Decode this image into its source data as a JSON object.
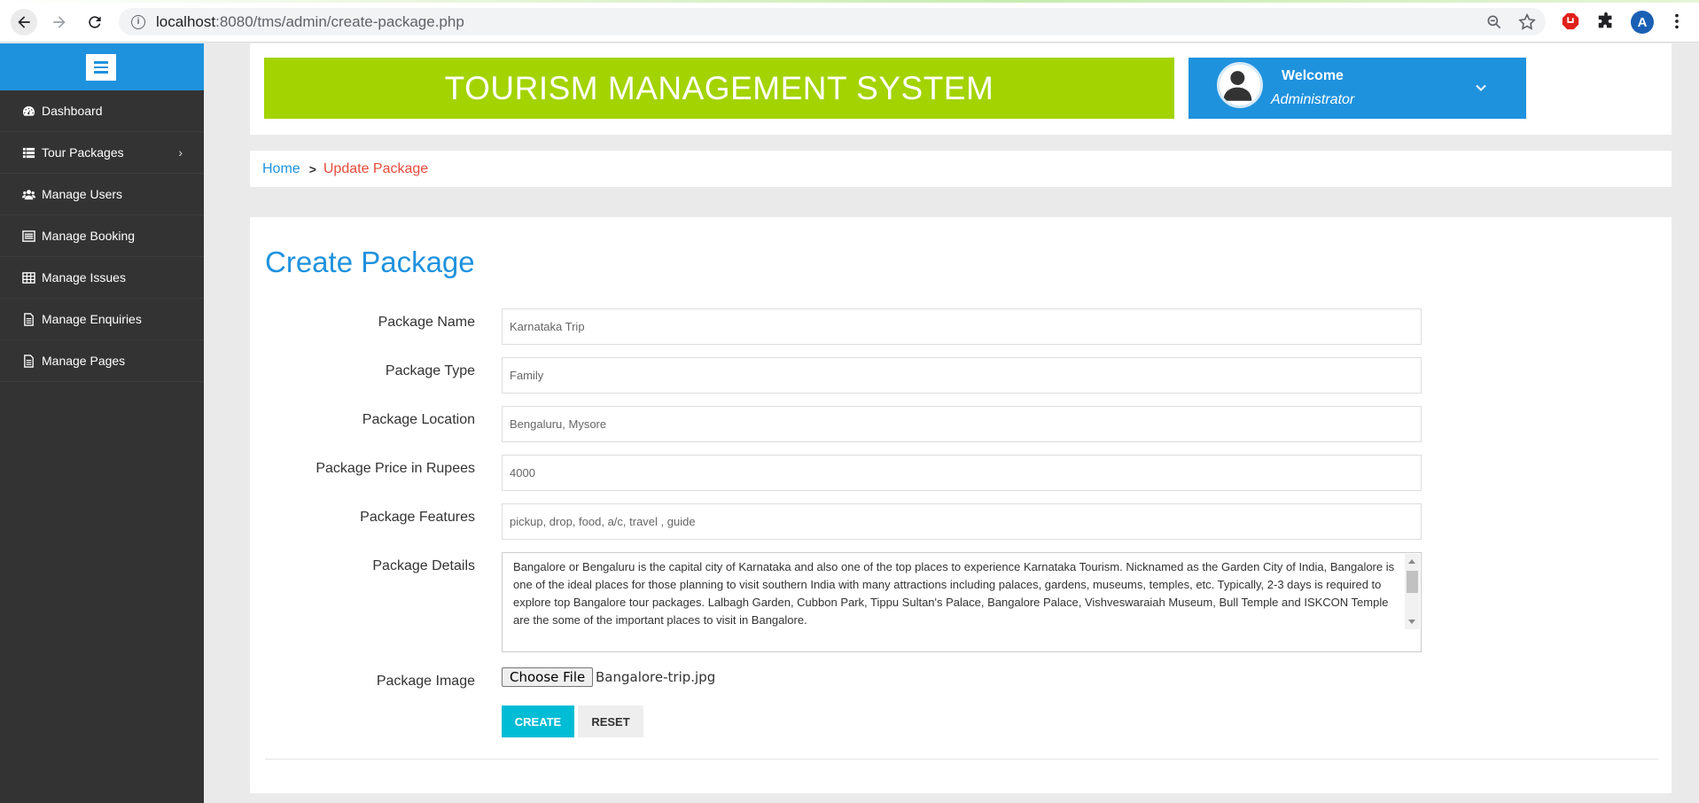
{
  "browser": {
    "url_host": "localhost",
    "url_path": ":8080/tms/admin/create-package.php",
    "avatar_letter": "A"
  },
  "sidebar": {
    "items": [
      {
        "label": "Dashboard",
        "icon": "dashboard-icon"
      },
      {
        "label": "Tour Packages",
        "icon": "list-icon",
        "has_submenu": true
      },
      {
        "label": "Manage Users",
        "icon": "users-icon"
      },
      {
        "label": "Manage Booking",
        "icon": "list-alt-icon"
      },
      {
        "label": "Manage Issues",
        "icon": "table-icon"
      },
      {
        "label": "Manage Enquiries",
        "icon": "file-icon"
      },
      {
        "label": "Manage Pages",
        "icon": "file-icon"
      }
    ]
  },
  "header": {
    "title": "TOURISM MANAGEMENT SYSTEM",
    "welcome": "Welcome",
    "role": "Administrator"
  },
  "breadcrumb": {
    "home": "Home",
    "current": "Update Package"
  },
  "form": {
    "title": "Create Package",
    "fields": [
      {
        "label": "Package Name",
        "value": "Karnataka Trip"
      },
      {
        "label": "Package Type",
        "value": "Family"
      },
      {
        "label": "Package Location",
        "value": "Bengaluru, Mysore"
      },
      {
        "label": "Package Price in Rupees",
        "value": "4000"
      },
      {
        "label": "Package Features",
        "value": "pickup, drop, food, a/c, travel , guide"
      }
    ],
    "details_label": "Package Details",
    "details_value": "Bangalore or Bengaluru is the capital city of Karnataka and also one of the top places to experience Karnataka Tourism. Nicknamed as the Garden City of India, Bangalore is one of the ideal places for those planning to visit southern India with many attractions including palaces, gardens, museums, temples, etc. Typically, 2-3 days is required to explore top Bangalore tour packages. Lalbagh Garden, Cubbon Park, Tippu Sultan's Palace, Bangalore Palace, Vishveswaraiah Museum, Bull Temple and ISKCON Temple are the some of the important places to visit in Bangalore.",
    "image_label": "Package Image",
    "choose_file": "Choose File",
    "file_name": "Bangalore-trip.jpg",
    "create_label": "CREATE",
    "reset_label": "RESET"
  },
  "colors": {
    "accent_blue": "#1f92de",
    "banner_green": "#a3d300",
    "sidebar_dark": "#333333",
    "create_cyan": "#00bcd4",
    "breadcrumb_red": "#e74c3c"
  }
}
